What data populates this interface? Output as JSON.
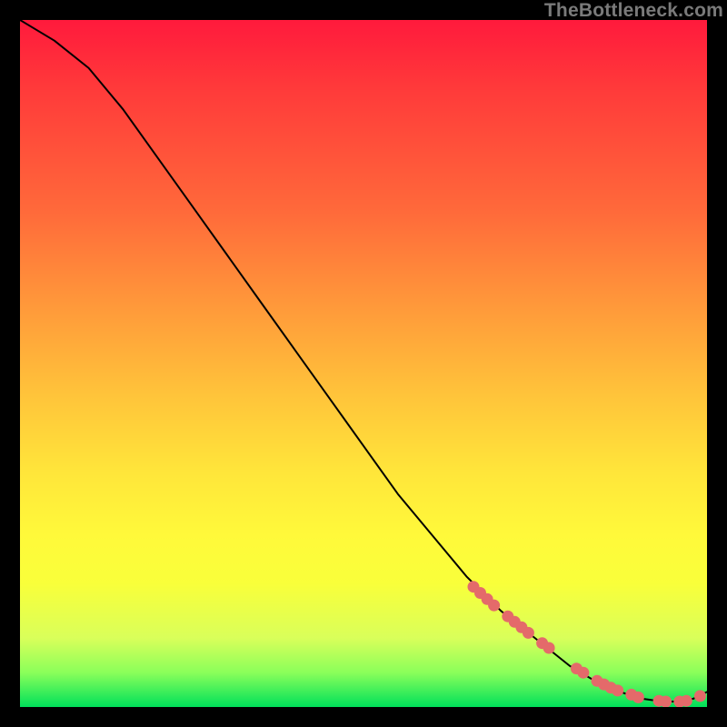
{
  "watermark": "TheBottleneck.com",
  "chart_data": {
    "type": "line",
    "title": "",
    "xlabel": "",
    "ylabel": "",
    "xlim": [
      0,
      100
    ],
    "ylim": [
      0,
      100
    ],
    "series": [
      {
        "name": "bottleneck-curve",
        "x": [
          0,
          5,
          10,
          15,
          20,
          25,
          30,
          35,
          40,
          45,
          50,
          55,
          60,
          65,
          70,
          75,
          80,
          85,
          88,
          90,
          92,
          94,
          96,
          98,
          100
        ],
        "y": [
          100,
          97,
          93,
          87,
          80,
          73,
          66,
          59,
          52,
          45,
          38,
          31,
          25,
          19,
          14,
          10,
          6,
          3,
          2,
          1.3,
          1,
          0.8,
          0.8,
          1.2,
          2.2
        ]
      }
    ],
    "markers": {
      "name": "highlighted-points",
      "x": [
        66,
        67,
        68,
        69,
        71,
        72,
        73,
        74,
        76,
        77,
        81,
        82,
        84,
        85,
        86,
        87,
        89,
        90,
        93,
        94,
        96,
        97,
        99
      ],
      "y": [
        17.5,
        16.6,
        15.7,
        14.8,
        13.2,
        12.4,
        11.6,
        10.8,
        9.3,
        8.6,
        5.6,
        5.0,
        3.8,
        3.3,
        2.8,
        2.4,
        1.8,
        1.4,
        0.9,
        0.8,
        0.8,
        0.9,
        1.6
      ]
    },
    "colors": {
      "curve": "#000000",
      "marker": "#e46a6a",
      "gradient_top": "#ff1a3c",
      "gradient_bottom": "#00e05a"
    }
  }
}
